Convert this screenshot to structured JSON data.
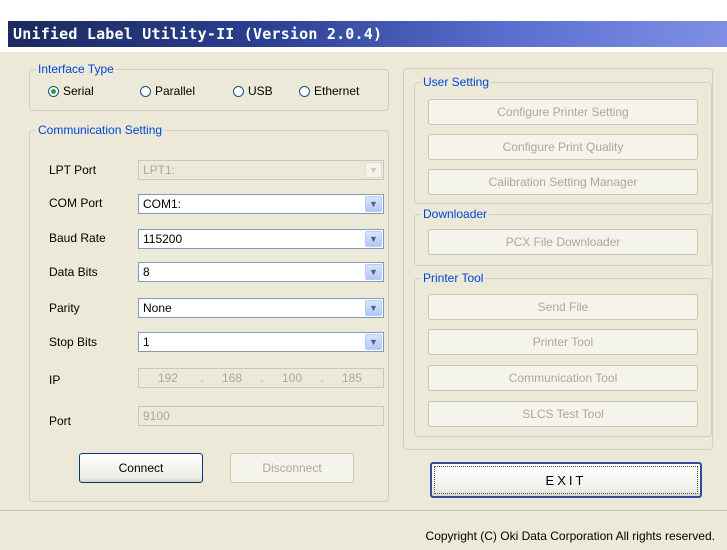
{
  "window": {
    "title": "Unified Label Utility-II (Version 2.0.4)"
  },
  "interface_type": {
    "legend": "Interface Type",
    "options": [
      {
        "label": "Serial",
        "checked": true
      },
      {
        "label": "Parallel",
        "checked": false
      },
      {
        "label": "USB",
        "checked": false
      },
      {
        "label": "Ethernet",
        "checked": false
      }
    ]
  },
  "communication": {
    "legend": "Communication Setting",
    "lpt_port": {
      "label": "LPT Port",
      "value": "LPT1:"
    },
    "com_port": {
      "label": "COM Port",
      "value": "COM1:"
    },
    "baud_rate": {
      "label": "Baud Rate",
      "value": "115200"
    },
    "data_bits": {
      "label": "Data Bits",
      "value": "8"
    },
    "parity": {
      "label": "Parity",
      "value": "None"
    },
    "stop_bits": {
      "label": "Stop Bits",
      "value": "1"
    },
    "ip": {
      "label": "IP",
      "octets": [
        "192",
        "168",
        "100",
        "185"
      ]
    },
    "port": {
      "label": "Port",
      "value": "9100"
    },
    "connect_label": "Connect",
    "disconnect_label": "Disconnect"
  },
  "user_setting": {
    "legend": "User Setting",
    "buttons": [
      "Configure Printer Setting",
      "Configure Print Quality",
      "Calibration Setting Manager"
    ]
  },
  "downloader": {
    "legend": "Downloader",
    "buttons": [
      "PCX File Downloader"
    ]
  },
  "printer_tool": {
    "legend": "Printer Tool",
    "buttons": [
      "Send File",
      "Printer Tool",
      "Communication Tool",
      "SLCS Test Tool"
    ]
  },
  "exit_label": "EXIT",
  "copyright": "Copyright (C) Oki Data Corporation All rights reserved.",
  "colors": {
    "title_bar": "#1b2a5e",
    "group_legend": "#0046d5",
    "window_bg": "#ece9d8",
    "radio_checked": "#2e9e2e"
  }
}
